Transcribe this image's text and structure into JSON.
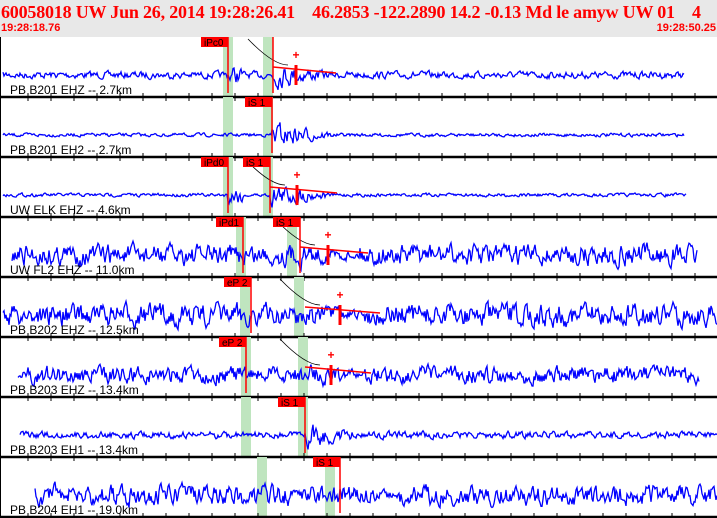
{
  "header": {
    "title": "60058018 UW Jun 26, 2014 19:28:26.41    46.2853 -122.2890 14.2 -0.13 Md le amyw UW 01    4",
    "start_time": "19:28:18.76",
    "end_time": "19:28:50.25"
  },
  "colors": {
    "trace": "#0000ff",
    "pick": "#ff0000",
    "window": "#bfe5bf",
    "header_text": "#ff0000"
  },
  "channels": [
    {
      "label": "PB B201 EHZ -- 2.7km",
      "amp": 4,
      "picks": [
        {
          "label": "iPc0",
          "t": 228
        },
        {
          "label": "",
          "t": 273
        }
      ],
      "plus": 296,
      "windows": [
        223,
        263
      ],
      "arrival": 228,
      "sArr": 273,
      "coda": true
    },
    {
      "label": "PB B201 EH2 -- 2.7km",
      "amp": 2,
      "picks": [
        {
          "label": "iS 1",
          "t": 272
        }
      ],
      "plus": null,
      "windows": [
        223,
        263
      ],
      "arrival": 272,
      "sArr": 272,
      "coda": false
    },
    {
      "label": "UW ELK EHZ -- 4.6km",
      "amp": 2,
      "picks": [
        {
          "label": "iPd0",
          "t": 228
        },
        {
          "label": "iS 1",
          "t": 270
        }
      ],
      "plus": 297,
      "windows": [
        223,
        263
      ],
      "arrival": 228,
      "sArr": 270,
      "coda": true
    },
    {
      "label": "UW FL2 EHZ -- 11.0km",
      "amp": 12,
      "picks": [
        {
          "label": "iPd1",
          "t": 243
        },
        {
          "label": "iS 1",
          "t": 300
        }
      ],
      "plus": 328,
      "windows": [
        236,
        287
      ],
      "arrival": 243,
      "sArr": 300,
      "coda": true
    },
    {
      "label": "PB B202 EHZ -- 12.5km",
      "amp": 13,
      "picks": [
        {
          "label": "eP 2",
          "t": 251
        }
      ],
      "plus": 340,
      "windows": [
        240,
        294
      ],
      "arrival": 251,
      "sArr": 305,
      "coda": true
    },
    {
      "label": "PB B203 EHZ -- 13.4km",
      "amp": 10,
      "picks": [
        {
          "label": "eP 2",
          "t": 246
        }
      ],
      "plus": 331,
      "windows": [
        241,
        298
      ],
      "arrival": 246,
      "sArr": 305,
      "coda": true
    },
    {
      "label": "PB B203 EH1 -- 13.4km",
      "amp": 4,
      "picks": [
        {
          "label": "iS 1",
          "t": 305
        }
      ],
      "plus": null,
      "windows": [
        241,
        298
      ],
      "arrival": 305,
      "sArr": 305,
      "coda": false
    },
    {
      "label": "PB B204 EH1 -- 19.0km",
      "amp": 12,
      "picks": [
        {
          "label": "iS 1",
          "t": 340
        }
      ],
      "plus": null,
      "windows": [
        257,
        325
      ],
      "arrival": 340,
      "sArr": 340,
      "coda": false
    }
  ]
}
